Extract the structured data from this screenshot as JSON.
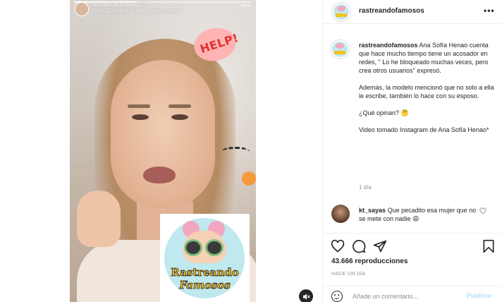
{
  "story": {
    "username": "anasofiahenaoe",
    "time": "20 h",
    "audio": "Ritual Perfect Skin de natysanchez05",
    "progress": 0.35,
    "sticker_text": "HELP!",
    "more_icon": "more-horizontal-icon"
  },
  "watermark": {
    "line1": "Rastreando",
    "line2": "Famosos"
  },
  "media": {
    "mute_icon": "volume-muted-icon"
  },
  "header": {
    "username": "rastreandofamosos",
    "more_label": "•••"
  },
  "caption": {
    "username": "rastreandofamosos",
    "paragraph1": "Ana Sofía Henao cuenta que hace mucho tiempo tiene un acosador en redes, \" Lo he bloqueado muchas veces, pero crea otros usuarios\" expresó.",
    "paragraph2": "Además, la modelo mencionó que no solo a ella le escribe, también lo hace con su esposo.",
    "paragraph3": "¿Qué opinan? 🤔",
    "paragraph4": "Video tomado Instagram de Ana Sofía Henao*",
    "time": "1 día"
  },
  "comment": {
    "username": "kt_sayas",
    "text": "Que pecadito esa mujer que no se mete con nadie 😩"
  },
  "actions": {
    "views": "43.666 reproducciones",
    "date": "HACE UN DÍA",
    "comment_placeholder": "Añade un comentario...",
    "publish_label": "Publicar"
  },
  "colors": {
    "accent": "#0095f6",
    "publish_disabled": "#b2dffc",
    "secondary_text": "#8e8e8e",
    "border": "#efefef"
  }
}
